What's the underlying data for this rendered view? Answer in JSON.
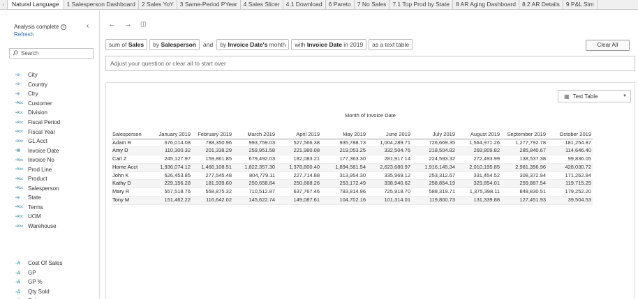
{
  "tabs": [
    {
      "label": "Natural Language",
      "active": true
    },
    {
      "label": "1 Salesperson Dashboard"
    },
    {
      "label": "2 Sales YoY"
    },
    {
      "label": "3 Same-Period PYear"
    },
    {
      "label": "4 Sales Slicer"
    },
    {
      "label": "4.1 Download"
    },
    {
      "label": "6 Pareto"
    },
    {
      "label": "7 No Sales"
    },
    {
      "label": "7.1 Top Prod by State"
    },
    {
      "label": "8 AR Aging Dashboard"
    },
    {
      "label": "8.2 AR Details"
    },
    {
      "label": "9 P&L Sim"
    }
  ],
  "left_panel": {
    "status": "Analysis complete",
    "refresh": "Refresh",
    "search_placeholder": "Search",
    "dimensions": [
      {
        "icon": "geo-icon",
        "glyph": "⊕",
        "label": "City"
      },
      {
        "icon": "geo-icon",
        "glyph": "⊕",
        "label": "Country"
      },
      {
        "icon": "geo-icon",
        "glyph": "⊕",
        "label": "Ctry"
      },
      {
        "icon": "string-icon",
        "glyph": "Abc",
        "label": "Customer"
      },
      {
        "icon": "string-icon",
        "glyph": "Abc",
        "label": "Division"
      },
      {
        "icon": "string-icon",
        "glyph": "Abc",
        "label": "Fiscal Period"
      },
      {
        "icon": "string-icon",
        "glyph": "Abc",
        "label": "Fiscal Year"
      },
      {
        "icon": "string-icon",
        "glyph": "Abc",
        "label": "GL Acct"
      },
      {
        "icon": "date-icon",
        "glyph": "▦",
        "label": "Invoice Date"
      },
      {
        "icon": "string-icon",
        "glyph": "Abc",
        "label": "Invoice No"
      },
      {
        "icon": "string-icon",
        "glyph": "Abc",
        "label": "Prod Line"
      },
      {
        "icon": "string-icon",
        "glyph": "Abc",
        "label": "Product"
      },
      {
        "icon": "string-icon",
        "glyph": "Abc",
        "label": "Salesperson"
      },
      {
        "icon": "geo-icon",
        "glyph": "⊕",
        "label": "State"
      },
      {
        "icon": "string-icon",
        "glyph": "Abc",
        "label": "Terms"
      },
      {
        "icon": "string-icon",
        "glyph": "Abc",
        "label": "UOM"
      },
      {
        "icon": "string-icon",
        "glyph": "Abc",
        "label": "Warehouse"
      }
    ],
    "measures": [
      {
        "icon": "measure-icon",
        "glyph": "#",
        "label": "Cost Of Sales"
      },
      {
        "icon": "measure-icon",
        "glyph": "#",
        "label": "GP"
      },
      {
        "icon": "measure-icon",
        "glyph": "#",
        "label": "GP %"
      },
      {
        "icon": "measure-icon",
        "glyph": "#",
        "label": "Qty Sold"
      },
      {
        "icon": "measure-icon",
        "glyph": "#",
        "label": "Sales"
      }
    ]
  },
  "query": {
    "p1_pre": "sum of ",
    "p1_bold": "Sales",
    "p2_pre": "by ",
    "p2_bold": "Salesperson",
    "and": "and",
    "p3_pre": "by ",
    "p3_bold": "Invoice Date's",
    "p3_post": " month",
    "p4_pre": "with ",
    "p4_bold": "Invoice Date",
    "p4_post": " in 2019",
    "p5": "as a text table",
    "clear_all": "Clear All",
    "ask_placeholder": "Adjust your question or clear all to start over"
  },
  "viz": {
    "type_label": "Text Table",
    "column_group_title": "Month of Invoice Date",
    "row_header": "Salesperson",
    "columns": [
      "January 2019",
      "February 2019",
      "March 2019",
      "April 2019",
      "May 2019",
      "June 2019",
      "July 2019",
      "August 2019",
      "September 2019",
      "October 2019"
    ],
    "rows": [
      {
        "name": "Adam R",
        "values": [
          "676,014.08",
          "788,350.96",
          "993,759.03",
          "527,566.38",
          "935,788.73",
          "1,004,289.71",
          "726,669.35",
          "1,564,971.26",
          "1,277,792.78",
          "181,254.87"
        ]
      },
      {
        "name": "Amy D",
        "values": [
          "110,300.32",
          "201,338.29",
          "259,951.58",
          "221,980.08",
          "219,053.25",
          "332,504.76",
          "218,504.82",
          "269,809.82",
          "285,840.67",
          "114,646.40"
        ]
      },
      {
        "name": "Carl Z",
        "values": [
          "245,127.97",
          "159,861.85",
          "679,492.03",
          "182,083.21",
          "177,363.30",
          "281,917.14",
          "224,593.32",
          "272,493.99",
          "138,537.38",
          "99,836.05"
        ]
      },
      {
        "name": "Home Acct",
        "values": [
          "1,936,074.12",
          "1,466,108.51",
          "1,822,357.30",
          "1,378,800.40",
          "1,894,581.54",
          "2,623,680.97",
          "1,916,145.34",
          "2,010,195.85",
          "2,981,356.96",
          "428,030.72"
        ]
      },
      {
        "name": "John K",
        "values": [
          "626,453.85",
          "277,545.48",
          "804,779.11",
          "227,714.88",
          "313,954.30",
          "335,969.12",
          "253,312.67",
          "331,454.52",
          "308,372.94",
          "171,262.84"
        ]
      },
      {
        "name": "Kathy D",
        "values": [
          "229,156.28",
          "181,939.60",
          "250,658.84",
          "250,668.26",
          "253,172.49",
          "338,940.62",
          "258,854.19",
          "329,854.01",
          "259,887.54",
          "119,715.25"
        ]
      },
      {
        "name": "Mary R",
        "values": [
          "557,518.76",
          "558,875.32",
          "710,512.87",
          "637,767.46",
          "783,814.96",
          "725,918.70",
          "588,319.71",
          "1,375,398.11",
          "848,830.51",
          "179,252.20"
        ]
      },
      {
        "name": "Tony M",
        "values": [
          "151,462.22",
          "116,642.02",
          "145,622.74",
          "149,087.61",
          "104,702.16",
          "101,314.01",
          "119,800.73",
          "131,339.88",
          "127,451.93",
          "39,504.53"
        ]
      }
    ]
  }
}
